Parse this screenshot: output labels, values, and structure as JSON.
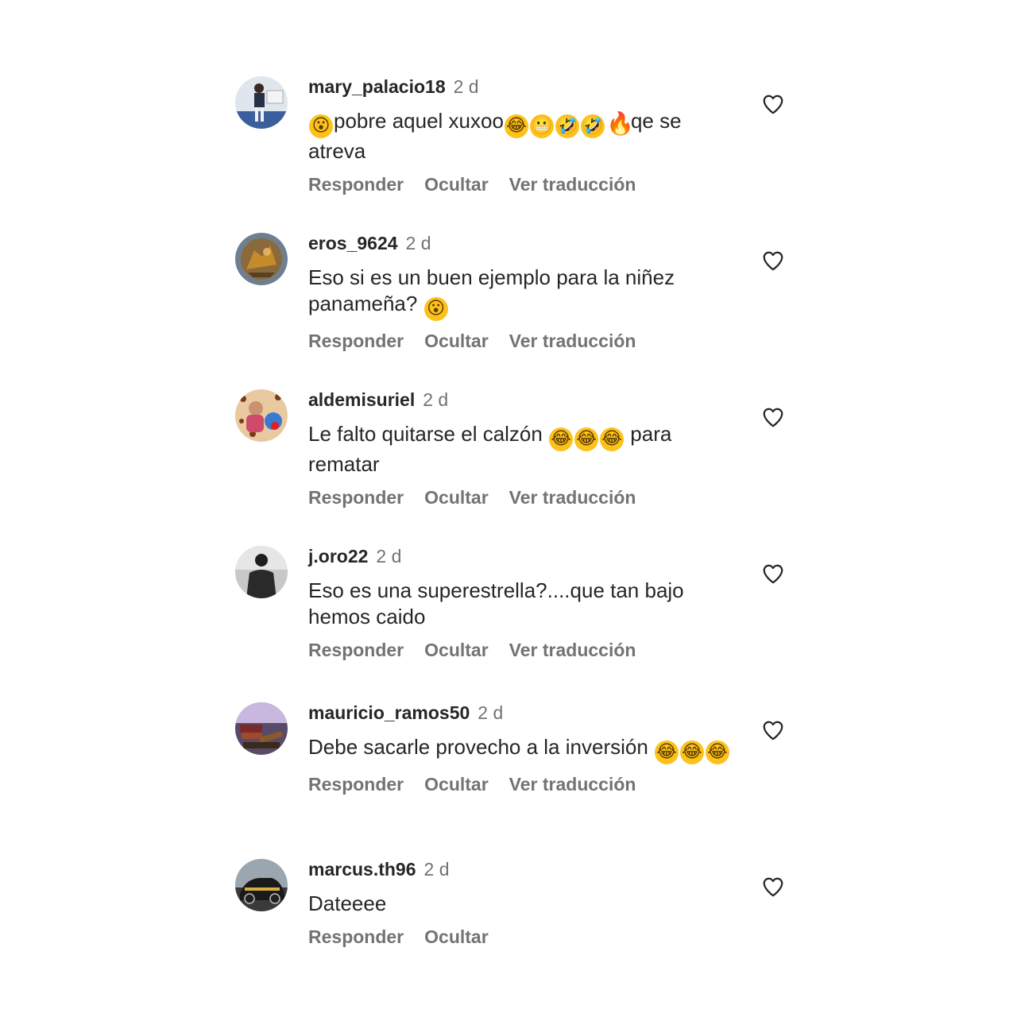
{
  "actions": {
    "reply": "Responder",
    "hide": "Ocultar",
    "translate": "Ver traducción"
  },
  "colors": {
    "username": "#262626",
    "secondary": "#737373",
    "background": "#ffffff"
  },
  "like_icon": "heart-outline-icon",
  "comments": [
    {
      "username": "mary_palacio18",
      "time": "2 d",
      "text_parts": [
        "",
        "pobre aquel xuxoo",
        "",
        "",
        "",
        "",
        "qe se atreva"
      ],
      "emojis": [
        "😮",
        "😂",
        "😬",
        "🤣",
        "🤣",
        "🔥"
      ]
    },
    {
      "username": "eros_9624",
      "time": "2 d",
      "text_parts": [
        "Eso si es un buen ejemplo para la niñez panameña? "
      ],
      "emojis": [
        "😮"
      ]
    },
    {
      "username": "aldemisuriel",
      "time": "2 d",
      "text_parts": [
        "Le falto quitarse el calzón ",
        "",
        "",
        " para rematar"
      ],
      "emojis": [
        "😂",
        "😂",
        "😂"
      ]
    },
    {
      "username": "j.oro22",
      "time": "2 d",
      "text": "Eso es una superestrella?....que tan bajo hemos caido"
    },
    {
      "username": "mauricio_ramos50",
      "time": "2 d",
      "text_parts": [
        "Debe sacarle provecho a la inversión ",
        "",
        ""
      ],
      "emojis": [
        "😂",
        "😂",
        "😂"
      ]
    },
    {
      "username": "marcus.th96",
      "time": "2 d",
      "text": "Dateeee"
    }
  ]
}
